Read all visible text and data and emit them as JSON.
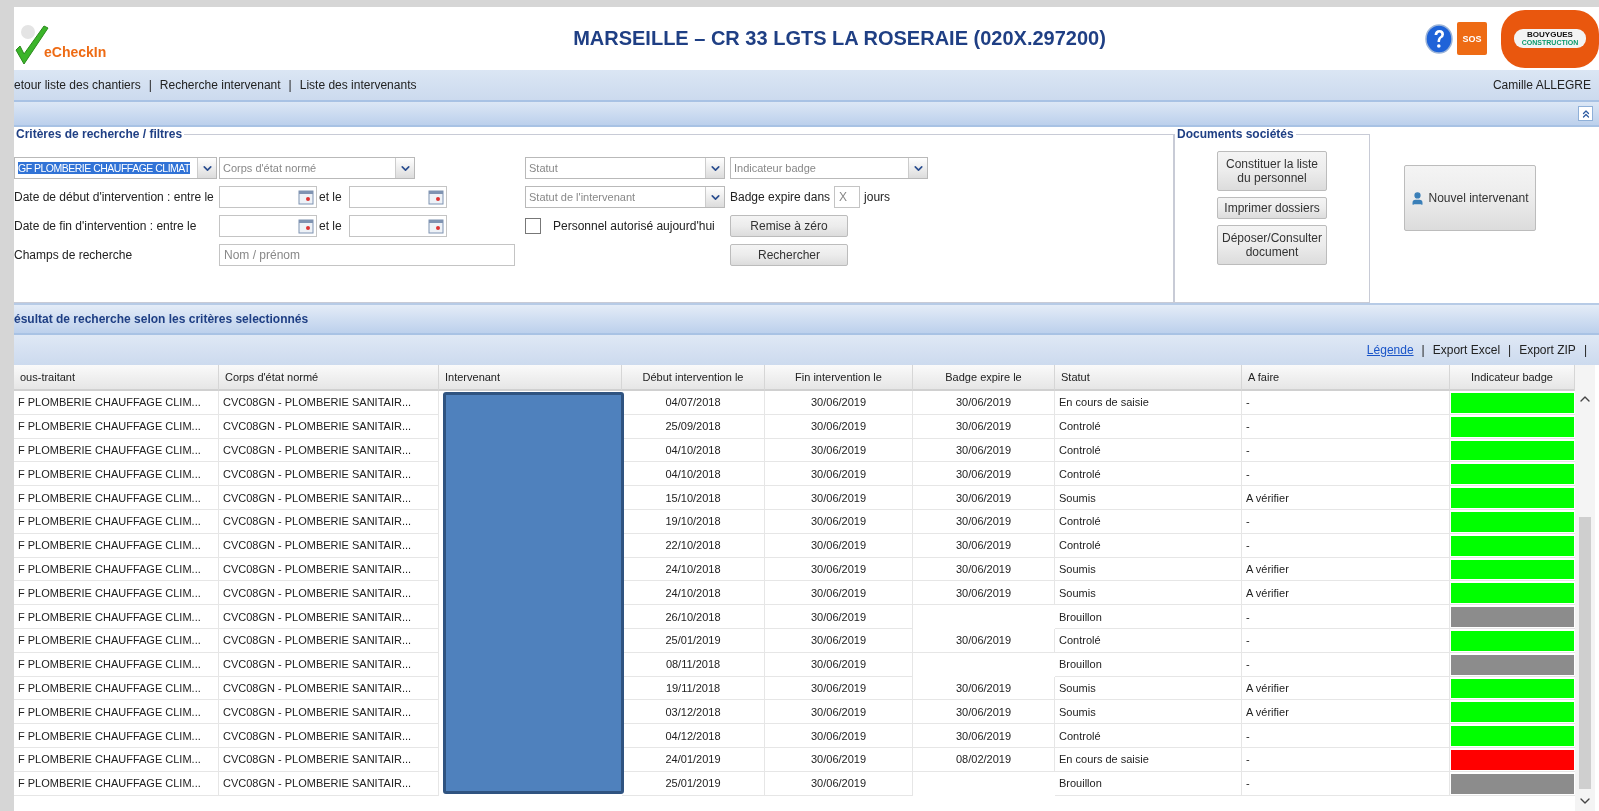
{
  "header": {
    "logo_text": "eCheckIn",
    "title": "MARSEILLE – CR 33 LGTS LA ROSERAIE (020X.297200)",
    "sos_label": "SOS",
    "brand": [
      "BOUYGUES",
      "CONSTRUCTION"
    ]
  },
  "nav": {
    "links": [
      "etour liste des chantiers",
      "Recherche intervenant",
      "Liste des intervenants"
    ],
    "separators": [
      "|",
      "|"
    ],
    "user": "Camille ALLEGRE"
  },
  "filters": {
    "legend": "Critères de recherche / filtres",
    "sous_traitant": "GF PLOMBERIE CHAUFFAGE CLIMAT",
    "corps_placeholder": "Corps d'état normé",
    "statut_placeholder": "Statut",
    "indicateur_placeholder": "Indicateur badge",
    "statut_intervenant_placeholder": "Statut de l'intervenant",
    "date_debut_label": "Date de début d'intervention : entre le",
    "date_fin_label": "Date de fin d'intervention : entre le",
    "et_le": [
      "et le",
      "et le"
    ],
    "search_label": "Champs de recherche",
    "search_placeholder": "Nom / prénom",
    "badge_expire": {
      "label": "Badge expire dans",
      "placeholder": "X",
      "unit": "jours"
    },
    "personnel_autorise": {
      "label": "Personnel autorisé aujourd'hui",
      "checked": false
    },
    "reset_button": "Remise à zéro",
    "search_button": "Rechercher"
  },
  "documents": {
    "legend": "Documents sociétés",
    "buttons": [
      "Constituer la liste du personnel",
      "Imprimer dossiers",
      "Déposer/Consulter document"
    ]
  },
  "new_button": "Nouvel intervenant",
  "results": {
    "title": "ésultat de recherche selon les critères selectionnés",
    "toolbar": [
      {
        "text": "Légende",
        "kind": "link"
      },
      {
        "text": "Export Excel",
        "kind": "action"
      },
      {
        "text": "Export ZIP",
        "kind": "action"
      }
    ],
    "separators": [
      "|",
      "|",
      "|"
    ]
  },
  "table": {
    "columns": [
      "ous-traitant",
      "Corps d'état normé",
      "Intervenant",
      "Début intervention le",
      "Fin intervention le",
      "Badge expire le",
      "Statut",
      "A faire",
      "Indicateur badge"
    ],
    "intervenant_redacted": true,
    "rows": [
      {
        "sous_traitant": "F PLOMBERIE CHAUFFAGE CLIM...",
        "corps": "CVC08GN - PLOMBERIE SANITAIR...",
        "debut": "04/07/2018",
        "fin": "30/06/2019",
        "badge_expire": "30/06/2019",
        "statut": "En cours de saisie",
        "a_faire": "-",
        "color": "#00ff00"
      },
      {
        "sous_traitant": "F PLOMBERIE CHAUFFAGE CLIM...",
        "corps": "CVC08GN - PLOMBERIE SANITAIR...",
        "debut": "25/09/2018",
        "fin": "30/06/2019",
        "badge_expire": "30/06/2019",
        "statut": "Controlé",
        "a_faire": "-",
        "color": "#00ff00"
      },
      {
        "sous_traitant": "F PLOMBERIE CHAUFFAGE CLIM...",
        "corps": "CVC08GN - PLOMBERIE SANITAIR...",
        "debut": "04/10/2018",
        "fin": "30/06/2019",
        "badge_expire": "30/06/2019",
        "statut": "Controlé",
        "a_faire": "-",
        "color": "#00ff00"
      },
      {
        "sous_traitant": "F PLOMBERIE CHAUFFAGE CLIM...",
        "corps": "CVC08GN - PLOMBERIE SANITAIR...",
        "debut": "04/10/2018",
        "fin": "30/06/2019",
        "badge_expire": "30/06/2019",
        "statut": "Controlé",
        "a_faire": "-",
        "color": "#00ff00"
      },
      {
        "sous_traitant": "F PLOMBERIE CHAUFFAGE CLIM...",
        "corps": "CVC08GN - PLOMBERIE SANITAIR...",
        "debut": "15/10/2018",
        "fin": "30/06/2019",
        "badge_expire": "30/06/2019",
        "statut": "Soumis",
        "a_faire": "A vérifier",
        "color": "#00ff00"
      },
      {
        "sous_traitant": "F PLOMBERIE CHAUFFAGE CLIM...",
        "corps": "CVC08GN - PLOMBERIE SANITAIR...",
        "debut": "19/10/2018",
        "fin": "30/06/2019",
        "badge_expire": "30/06/2019",
        "statut": "Controlé",
        "a_faire": "-",
        "color": "#00ff00"
      },
      {
        "sous_traitant": "F PLOMBERIE CHAUFFAGE CLIM...",
        "corps": "CVC08GN - PLOMBERIE SANITAIR...",
        "debut": "22/10/2018",
        "fin": "30/06/2019",
        "badge_expire": "30/06/2019",
        "statut": "Controlé",
        "a_faire": "-",
        "color": "#00ff00"
      },
      {
        "sous_traitant": "F PLOMBERIE CHAUFFAGE CLIM...",
        "corps": "CVC08GN - PLOMBERIE SANITAIR...",
        "debut": "24/10/2018",
        "fin": "30/06/2019",
        "badge_expire": "30/06/2019",
        "statut": "Soumis",
        "a_faire": "A vérifier",
        "color": "#00ff00"
      },
      {
        "sous_traitant": "F PLOMBERIE CHAUFFAGE CLIM...",
        "corps": "CVC08GN - PLOMBERIE SANITAIR...",
        "debut": "24/10/2018",
        "fin": "30/06/2019",
        "badge_expire": "30/06/2019",
        "statut": "Soumis",
        "a_faire": "A vérifier",
        "color": "#00ff00"
      },
      {
        "sous_traitant": "F PLOMBERIE CHAUFFAGE CLIM...",
        "corps": "CVC08GN - PLOMBERIE SANITAIR...",
        "debut": "26/10/2018",
        "fin": "30/06/2019",
        "statut": "Brouillon",
        "a_faire": "-",
        "color": "#8c8c8c"
      },
      {
        "sous_traitant": "F PLOMBERIE CHAUFFAGE CLIM...",
        "corps": "CVC08GN - PLOMBERIE SANITAIR...",
        "debut": "25/01/2019",
        "fin": "30/06/2019",
        "badge_expire": "30/06/2019",
        "statut": "Controlé",
        "a_faire": "-",
        "color": "#00ff00"
      },
      {
        "sous_traitant": "F PLOMBERIE CHAUFFAGE CLIM...",
        "corps": "CVC08GN - PLOMBERIE SANITAIR...",
        "debut": "08/11/2018",
        "fin": "30/06/2019",
        "statut": "Brouillon",
        "a_faire": "-",
        "color": "#8c8c8c"
      },
      {
        "sous_traitant": "F PLOMBERIE CHAUFFAGE CLIM...",
        "corps": "CVC08GN - PLOMBERIE SANITAIR...",
        "debut": "19/11/2018",
        "fin": "30/06/2019",
        "badge_expire": "30/06/2019",
        "statut": "Soumis",
        "a_faire": "A vérifier",
        "color": "#00ff00"
      },
      {
        "sous_traitant": "F PLOMBERIE CHAUFFAGE CLIM...",
        "corps": "CVC08GN - PLOMBERIE SANITAIR...",
        "debut": "03/12/2018",
        "fin": "30/06/2019",
        "badge_expire": "30/06/2019",
        "statut": "Soumis",
        "a_faire": "A vérifier",
        "color": "#00ff00"
      },
      {
        "sous_traitant": "F PLOMBERIE CHAUFFAGE CLIM...",
        "corps": "CVC08GN - PLOMBERIE SANITAIR...",
        "debut": "04/12/2018",
        "fin": "30/06/2019",
        "badge_expire": "30/06/2019",
        "statut": "Controlé",
        "a_faire": "-",
        "color": "#00ff00"
      },
      {
        "sous_traitant": "F PLOMBERIE CHAUFFAGE CLIM...",
        "corps": "CVC08GN - PLOMBERIE SANITAIR...",
        "debut": "24/01/2019",
        "fin": "30/06/2019",
        "badge_expire": "08/02/2019",
        "statut": "En cours de saisie",
        "a_faire": "-",
        "color": "#ff0000"
      },
      {
        "sous_traitant": "F PLOMBERIE CHAUFFAGE CLIM...",
        "corps": "CVC08GN - PLOMBERIE SANITAIR...",
        "debut": "25/01/2019",
        "fin": "30/06/2019",
        "statut": "Brouillon",
        "a_faire": "-",
        "color": "#8c8c8c"
      }
    ]
  }
}
